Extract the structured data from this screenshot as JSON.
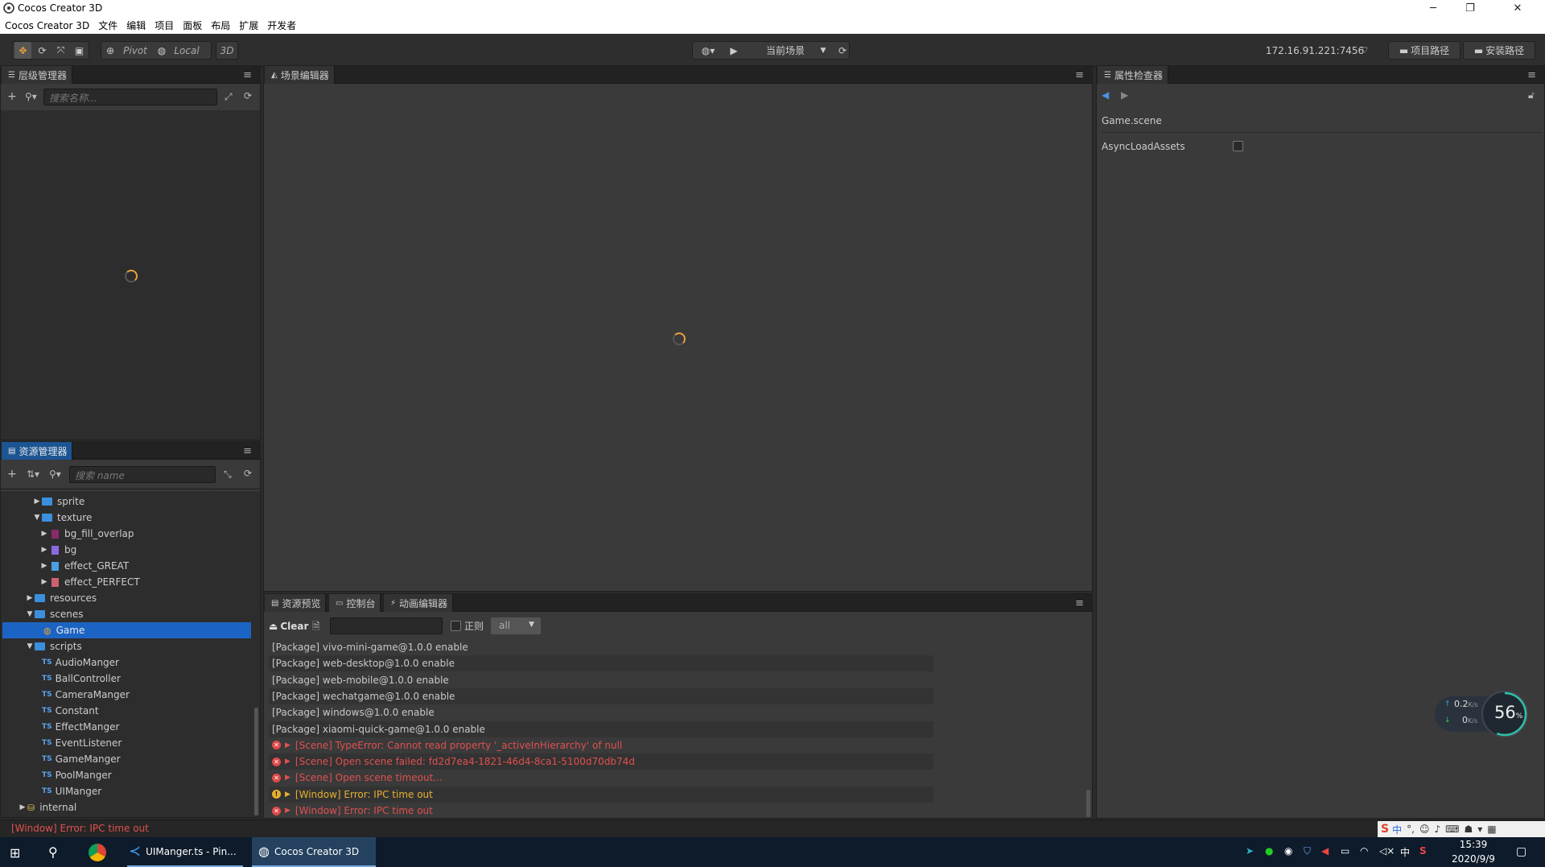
{
  "window": {
    "title": "Cocos Creator 3D",
    "minimize": "─",
    "maximize": "❐",
    "close": "✕"
  },
  "menu": [
    "Cocos Creator 3D",
    "文件",
    "编辑",
    "项目",
    "面板",
    "布局",
    "扩展",
    "开发者"
  ],
  "toolbar": {
    "pivot": "Pivot",
    "local": "Local",
    "mode3d": "3D",
    "scene_select": "当前场景",
    "ip": "172.16.91.221:7456",
    "project_path": "项目路径",
    "install_path": "安装路径"
  },
  "hierarchy": {
    "tab": "层级管理器",
    "search_placeholder": "搜索名称..."
  },
  "scene": {
    "tab": "场景编辑器"
  },
  "assets": {
    "tab": "资源管理器",
    "search_placeholder": "搜索 name",
    "items": [
      {
        "label": "sprite",
        "kind": "folder",
        "arrow": "▶",
        "level": 3
      },
      {
        "label": "texture",
        "kind": "folder",
        "arrow": "▼",
        "level": 3
      },
      {
        "label": "bg_fill_overlap",
        "kind": "texture",
        "arrow": "▶",
        "level": 4,
        "color": "#8a2a6a"
      },
      {
        "label": "bg",
        "kind": "texture",
        "arrow": "▶",
        "level": 4,
        "color": "#8a6ae0"
      },
      {
        "label": "effect_GREAT",
        "kind": "texture",
        "arrow": "▶",
        "level": 4,
        "color": "#4aa0e0"
      },
      {
        "label": "effect_PERFECT",
        "kind": "texture",
        "arrow": "▶",
        "level": 4,
        "color": "#d06070"
      },
      {
        "label": "resources",
        "kind": "folder",
        "arrow": "▶",
        "level": 2
      },
      {
        "label": "scenes",
        "kind": "folder",
        "arrow": "▼",
        "level": 2
      },
      {
        "label": "Game",
        "kind": "scene",
        "arrow": "",
        "level": 3,
        "selected": true
      },
      {
        "label": "scripts",
        "kind": "folder",
        "arrow": "▼",
        "level": 2
      },
      {
        "label": "AudioManger",
        "kind": "script",
        "level": 3
      },
      {
        "label": "BallController",
        "kind": "script",
        "level": 3
      },
      {
        "label": "CameraManger",
        "kind": "script",
        "level": 3
      },
      {
        "label": "Constant",
        "kind": "script",
        "level": 3
      },
      {
        "label": "EffectManger",
        "kind": "script",
        "level": 3
      },
      {
        "label": "EventListener",
        "kind": "script",
        "level": 3
      },
      {
        "label": "GameManger",
        "kind": "script",
        "level": 3
      },
      {
        "label": "PoolManger",
        "kind": "script",
        "level": 3
      },
      {
        "label": "UIManger",
        "kind": "script",
        "level": 3
      },
      {
        "label": "internal",
        "kind": "db",
        "arrow": "▶",
        "level": 1
      }
    ]
  },
  "bottom_tabs": [
    "资源预览",
    "控制台",
    "动画编辑器"
  ],
  "console": {
    "clear": "Clear",
    "regex": "正则",
    "filter": "all",
    "logs": [
      {
        "type": "info",
        "text": "[Package] vivo-mini-game@1.0.0 enable"
      },
      {
        "type": "info",
        "text": "[Package] web-desktop@1.0.0 enable"
      },
      {
        "type": "info",
        "text": "[Package] web-mobile@1.0.0 enable"
      },
      {
        "type": "info",
        "text": "[Package] wechatgame@1.0.0 enable"
      },
      {
        "type": "info",
        "text": "[Package] windows@1.0.0 enable"
      },
      {
        "type": "info",
        "text": "[Package] xiaomi-quick-game@1.0.0 enable"
      },
      {
        "type": "err",
        "text": "[Scene] TypeError: Cannot read property '_activeInHierarchy' of null"
      },
      {
        "type": "err",
        "text": "[Scene] Open scene failed: fd2d7ea4-1821-46d4-8ca1-5100d70db74d"
      },
      {
        "type": "err",
        "text": "[Scene] Open scene timeout..."
      },
      {
        "type": "warn",
        "text": "[Window] Error: IPC time out"
      },
      {
        "type": "err",
        "text": "[Window] Error: IPC time out"
      }
    ]
  },
  "inspector": {
    "tab": "属性检查器",
    "scene_name": "Game.scene",
    "prop": "AsyncLoadAssets"
  },
  "status": {
    "message": "[Window] Error: IPC time out"
  },
  "netmeter": {
    "up": "0.2",
    "down": "0",
    "unit": "K/s",
    "percent": "56",
    "pct_sign": "%",
    "level": 0.56
  },
  "taskbar": {
    "vscode": "UIManger.ts - Pin...",
    "cocos": "Cocos Creator 3D",
    "time": "15:39",
    "date": "2020/9/9",
    "ime": "中"
  },
  "colors": {
    "accent": "#1c5594",
    "selected": "#1c64c4",
    "error": "#e05050",
    "warn": "#e6b02e",
    "loader": "#e8a23a"
  }
}
